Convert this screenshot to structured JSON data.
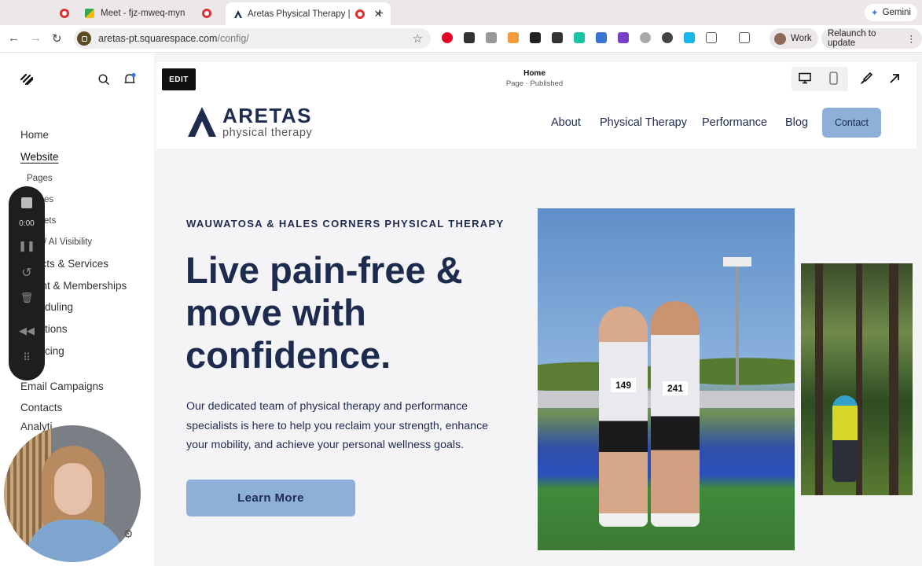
{
  "browser": {
    "tabs": [
      {
        "label": ""
      },
      {
        "label": "Meet - fjz-mweq-myn"
      },
      {
        "label": "Aretas Physical Therapy |"
      }
    ],
    "gemini_label": "Gemini",
    "url_domain": "aretas-pt.squarespace.com",
    "url_path": "/config/",
    "profile_label": "Work",
    "relaunch_label": "Relaunch to update"
  },
  "sidebar": {
    "items": [
      {
        "label": "Home"
      },
      {
        "label": "Website"
      },
      {
        "label": "Pages"
      },
      {
        "label": "es"
      },
      {
        "label": "ets"
      },
      {
        "label": "/ AI Visibility"
      },
      {
        "label": "ucts & Services"
      },
      {
        "label": "ent & Memberships"
      },
      {
        "label": "duling"
      },
      {
        "label": "tions"
      },
      {
        "label": "cing"
      },
      {
        "label": "Email Campaigns"
      },
      {
        "label": "Contacts"
      },
      {
        "label": "Analyti"
      }
    ]
  },
  "recorder": {
    "time": "0:00"
  },
  "editor": {
    "edit_label": "EDIT",
    "page_title": "Home",
    "page_status": "Page · Published"
  },
  "site": {
    "logo_name": "ARETAS",
    "logo_sub": "physical therapy",
    "nav": [
      "About",
      "Physical Therapy",
      "Performance",
      "Blog"
    ],
    "contact_label": "Contact",
    "eyebrow": "WAUWATOSA & HALES CORNERS PHYSICAL THERAPY",
    "headline": "Live pain-free & move with confidence.",
    "body": "Our dedicated team of physical therapy and performance specialists is here to help you reclaim your strength, enhance your mobility, and achieve your personal wellness goals.",
    "cta_label": "Learn More",
    "bib_1": "149",
    "bib_2": "241"
  },
  "colors": {
    "navy": "#1d2b4f",
    "button_blue": "#8eafd8",
    "recording_red": "#dd3333"
  }
}
